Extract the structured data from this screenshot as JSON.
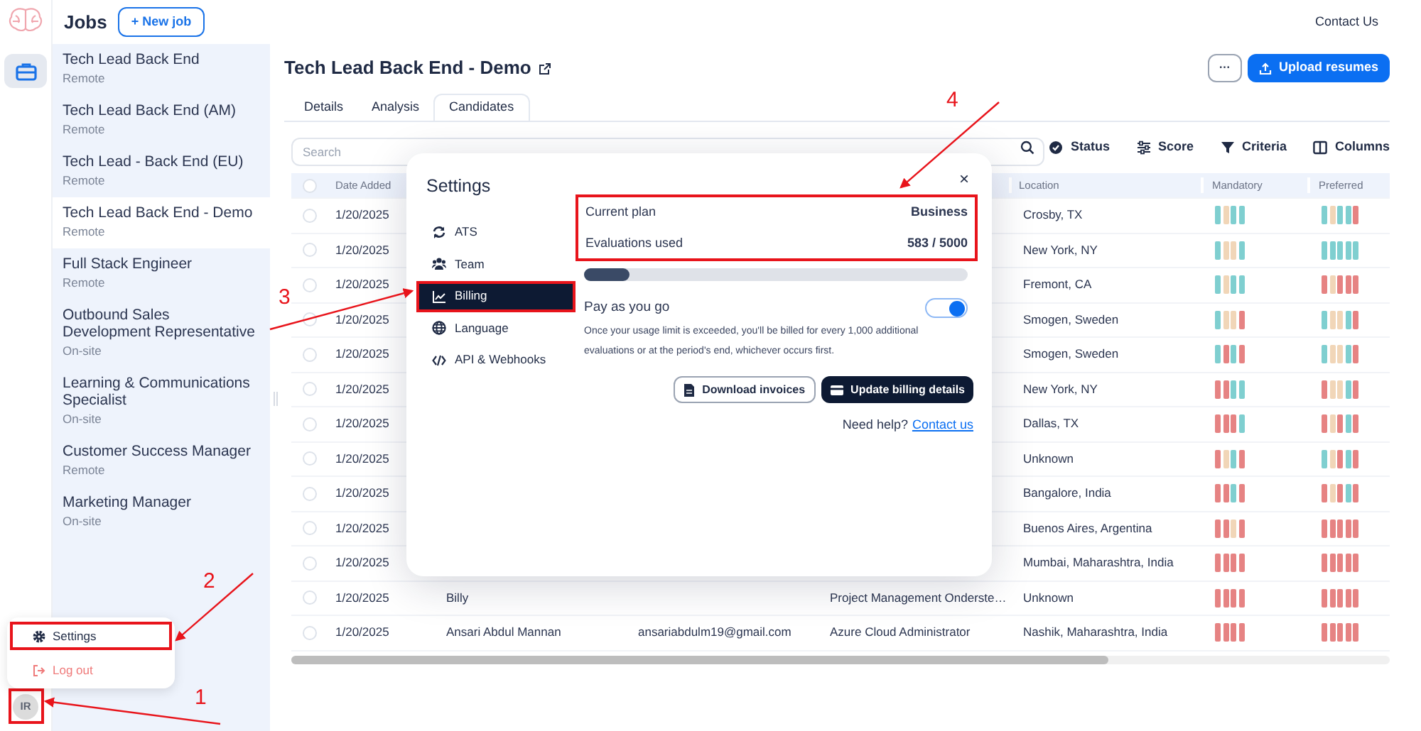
{
  "app": {
    "section_title": "Jobs",
    "new_job_button": "+ New job",
    "contact_link": "Contact Us"
  },
  "jobs": [
    {
      "title": "Tech Lead Back End",
      "location": "Remote",
      "selected": false
    },
    {
      "title": "Tech Lead Back End (AM)",
      "location": "Remote",
      "selected": false
    },
    {
      "title": "Tech Lead - Back End (EU)",
      "location": "Remote",
      "selected": false
    },
    {
      "title": "Tech Lead Back End - Demo",
      "location": "Remote",
      "selected": true
    },
    {
      "title": "Full Stack Engineer",
      "location": "Remote",
      "selected": false
    },
    {
      "title": "Outbound Sales Development Representative",
      "location": "On-site",
      "selected": false
    },
    {
      "title": "Learning & Communications Specialist",
      "location": "On-site",
      "selected": false
    },
    {
      "title": "Customer Success Manager",
      "location": "Remote",
      "selected": false
    },
    {
      "title": "Marketing Manager",
      "location": "On-site",
      "selected": false
    }
  ],
  "job_header": {
    "title": "Tech Lead Back End - Demo",
    "more_button": "···",
    "upload_button": "Upload resumes"
  },
  "tabs": [
    {
      "label": "Details",
      "selected": false
    },
    {
      "label": "Analysis",
      "selected": false
    },
    {
      "label": "Candidates",
      "selected": true
    }
  ],
  "toolbar": {
    "search_placeholder": "Search",
    "filters": [
      {
        "kind": "status",
        "label": "Status"
      },
      {
        "kind": "score",
        "label": "Score"
      },
      {
        "kind": "criteria",
        "label": "Criteria"
      },
      {
        "kind": "columns",
        "label": "Columns"
      }
    ]
  },
  "table": {
    "select_all_checked": false,
    "columns": {
      "date": "Date Added",
      "location": "Location",
      "mandatory": "Mandatory",
      "preferred": "Preferred"
    },
    "rows": [
      {
        "checked": false,
        "date": "1/20/2025",
        "location": "Crosby, TX",
        "mandatory": [
          {
            "color": "#7fcfd0"
          },
          {
            "color": "#f1d6b8"
          },
          {
            "color": "#7fcfd0"
          },
          {
            "color": "#7fcfd0"
          }
        ],
        "preferred": [
          {
            "color": "#7fcfd0"
          },
          {
            "color": "#f1d6b8"
          },
          {
            "color": "#7fcfd0"
          },
          {
            "color": "#7fcfd0"
          },
          {
            "color": "#e68383"
          }
        ]
      },
      {
        "checked": false,
        "date": "1/20/2025",
        "location": "New York, NY",
        "mandatory": [
          {
            "color": "#7fcfd0"
          },
          {
            "color": "#f1d6b8"
          },
          {
            "color": "#f1d6b8"
          },
          {
            "color": "#7fcfd0"
          }
        ],
        "preferred": [
          {
            "color": "#7fcfd0"
          },
          {
            "color": "#7fcfd0"
          },
          {
            "color": "#7fcfd0"
          },
          {
            "color": "#7fcfd0"
          },
          {
            "color": "#7fcfd0"
          }
        ]
      },
      {
        "checked": false,
        "date": "1/20/2025",
        "location": "Fremont, CA",
        "mandatory": [
          {
            "color": "#7fcfd0"
          },
          {
            "color": "#f1d6b8"
          },
          {
            "color": "#7fcfd0"
          },
          {
            "color": "#7fcfd0"
          }
        ],
        "preferred": [
          {
            "color": "#e68383"
          },
          {
            "color": "#f1d6b8"
          },
          {
            "color": "#e68383"
          },
          {
            "color": "#e68383"
          },
          {
            "color": "#e68383"
          }
        ]
      },
      {
        "checked": false,
        "date": "1/20/2025",
        "location": "Smogen, Sweden",
        "mandatory": [
          {
            "color": "#7fcfd0"
          },
          {
            "color": "#f1d6b8"
          },
          {
            "color": "#f1d6b8"
          },
          {
            "color": "#e68383"
          }
        ],
        "preferred": [
          {
            "color": "#7fcfd0"
          },
          {
            "color": "#f1d6b8"
          },
          {
            "color": "#f1d6b8"
          },
          {
            "color": "#7fcfd0"
          },
          {
            "color": "#e68383"
          }
        ]
      },
      {
        "checked": false,
        "date": "1/20/2025",
        "location": "Smogen, Sweden",
        "mandatory": [
          {
            "color": "#7fcfd0"
          },
          {
            "color": "#e68383"
          },
          {
            "color": "#7fcfd0"
          },
          {
            "color": "#e68383"
          }
        ],
        "preferred": [
          {
            "color": "#7fcfd0"
          },
          {
            "color": "#f1d6b8"
          },
          {
            "color": "#f1d6b8"
          },
          {
            "color": "#7fcfd0"
          },
          {
            "color": "#e68383"
          }
        ]
      },
      {
        "checked": false,
        "date": "1/20/2025",
        "location": "New York, NY",
        "mandatory": [
          {
            "color": "#e68383"
          },
          {
            "color": "#e68383"
          },
          {
            "color": "#7fcfd0"
          },
          {
            "color": "#7fcfd0"
          }
        ],
        "preferred": [
          {
            "color": "#e68383"
          },
          {
            "color": "#f1d6b8"
          },
          {
            "color": "#f1d6b8"
          },
          {
            "color": "#7fcfd0"
          },
          {
            "color": "#e68383"
          }
        ]
      },
      {
        "checked": false,
        "date": "1/20/2025",
        "location": "Dallas, TX",
        "mandatory": [
          {
            "color": "#e68383"
          },
          {
            "color": "#e68383"
          },
          {
            "color": "#e68383"
          },
          {
            "color": "#7fcfd0"
          }
        ],
        "preferred": [
          {
            "color": "#e68383"
          },
          {
            "color": "#f1d6b8"
          },
          {
            "color": "#e68383"
          },
          {
            "color": "#7fcfd0"
          },
          {
            "color": "#e68383"
          }
        ]
      },
      {
        "checked": false,
        "date": "1/20/2025",
        "location": "Unknown",
        "mandatory": [
          {
            "color": "#e68383"
          },
          {
            "color": "#f1d6b8"
          },
          {
            "color": "#7fcfd0"
          },
          {
            "color": "#e68383"
          }
        ],
        "preferred": [
          {
            "color": "#7fcfd0"
          },
          {
            "color": "#f1d6b8"
          },
          {
            "color": "#e68383"
          },
          {
            "color": "#7fcfd0"
          },
          {
            "color": "#e68383"
          }
        ]
      },
      {
        "checked": false,
        "date": "1/20/2025",
        "location": "Bangalore, India",
        "mandatory": [
          {
            "color": "#e68383"
          },
          {
            "color": "#e68383"
          },
          {
            "color": "#7fcfd0"
          },
          {
            "color": "#e68383"
          }
        ],
        "preferred": [
          {
            "color": "#e68383"
          },
          {
            "color": "#f1d6b8"
          },
          {
            "color": "#e68383"
          },
          {
            "color": "#7fcfd0"
          },
          {
            "color": "#e68383"
          }
        ]
      },
      {
        "checked": false,
        "date": "1/20/2025",
        "location": "Buenos Aires, Argentina",
        "mandatory": [
          {
            "color": "#e68383"
          },
          {
            "color": "#e68383"
          },
          {
            "color": "#f1d6b8"
          },
          {
            "color": "#e68383"
          }
        ],
        "preferred": [
          {
            "color": "#e68383"
          },
          {
            "color": "#e68383"
          },
          {
            "color": "#e68383"
          },
          {
            "color": "#e68383"
          },
          {
            "color": "#e68383"
          }
        ]
      },
      {
        "checked": false,
        "date": "1/20/2025",
        "location": "Mumbai, Maharashtra, India",
        "mandatory": [
          {
            "color": "#e68383"
          },
          {
            "color": "#e68383"
          },
          {
            "color": "#e68383"
          },
          {
            "color": "#e68383"
          }
        ],
        "preferred": [
          {
            "color": "#e68383"
          },
          {
            "color": "#e68383"
          },
          {
            "color": "#e68383"
          },
          {
            "color": "#e68383"
          },
          {
            "color": "#e68383"
          }
        ]
      },
      {
        "checked": false,
        "date": "1/20/2025",
        "name": "Billy",
        "job_title": "Project Management Onderste…",
        "location": "Unknown",
        "mandatory": [
          {
            "color": "#e68383"
          },
          {
            "color": "#e68383"
          },
          {
            "color": "#e68383"
          },
          {
            "color": "#e68383"
          }
        ],
        "preferred": [
          {
            "color": "#e68383"
          },
          {
            "color": "#e68383"
          },
          {
            "color": "#e68383"
          },
          {
            "color": "#e68383"
          },
          {
            "color": "#e68383"
          }
        ]
      },
      {
        "checked": false,
        "date": "1/20/2025",
        "name": "Ansari Abdul Mannan",
        "email": "ansariabdulm19@gmail.com",
        "job_title": "Azure Cloud Administrator",
        "location": "Nashik, Maharashtra, India",
        "mandatory": [
          {
            "color": "#e68383"
          },
          {
            "color": "#e68383"
          },
          {
            "color": "#e68383"
          },
          {
            "color": "#e68383"
          }
        ],
        "preferred": [
          {
            "color": "#e68383"
          },
          {
            "color": "#e68383"
          },
          {
            "color": "#e68383"
          },
          {
            "color": "#e68383"
          },
          {
            "color": "#e68383"
          }
        ]
      }
    ]
  },
  "user_menu": {
    "items": [
      {
        "kind": "settings",
        "label": "Settings",
        "highlighted": true
      },
      {
        "kind": "logout",
        "label": "Log out",
        "highlighted": false
      }
    ],
    "avatar": {
      "initials": "IR",
      "highlighted": true
    }
  },
  "settings_dialog": {
    "title": "Settings",
    "close": "×",
    "nav": [
      {
        "kind": "ats",
        "label": "ATS",
        "selected": false,
        "highlighted": false
      },
      {
        "kind": "team",
        "label": "Team",
        "selected": false,
        "highlighted": false
      },
      {
        "kind": "billing",
        "label": "Billing",
        "selected": true,
        "highlighted": true
      },
      {
        "kind": "language",
        "label": "Language",
        "selected": false,
        "highlighted": false
      },
      {
        "kind": "api",
        "label": "API & Webhooks",
        "selected": false,
        "highlighted": false
      }
    ],
    "plan": {
      "highlighted": true,
      "rows": [
        {
          "label": "Current plan",
          "value": "Business"
        },
        {
          "label": "Evaluations used",
          "value": "583 / 5000"
        }
      ]
    },
    "usage": {
      "level": 0.117
    },
    "pay_as_you_go": {
      "label": "Pay as you go",
      "on": true,
      "description": "Once your usage limit is exceeded, you'll be billed for every 1,000 additional evaluations or at the period's end, whichever occurs first."
    },
    "buttons": [
      {
        "kind": "outline",
        "label": "Download invoices"
      },
      {
        "kind": "dark",
        "label": "Update billing details"
      }
    ],
    "help": {
      "text": "Need help?",
      "link": "Contact us"
    }
  },
  "annotations": [
    {
      "label": "1"
    },
    {
      "label": "2"
    },
    {
      "label": "3"
    },
    {
      "label": "4"
    }
  ]
}
